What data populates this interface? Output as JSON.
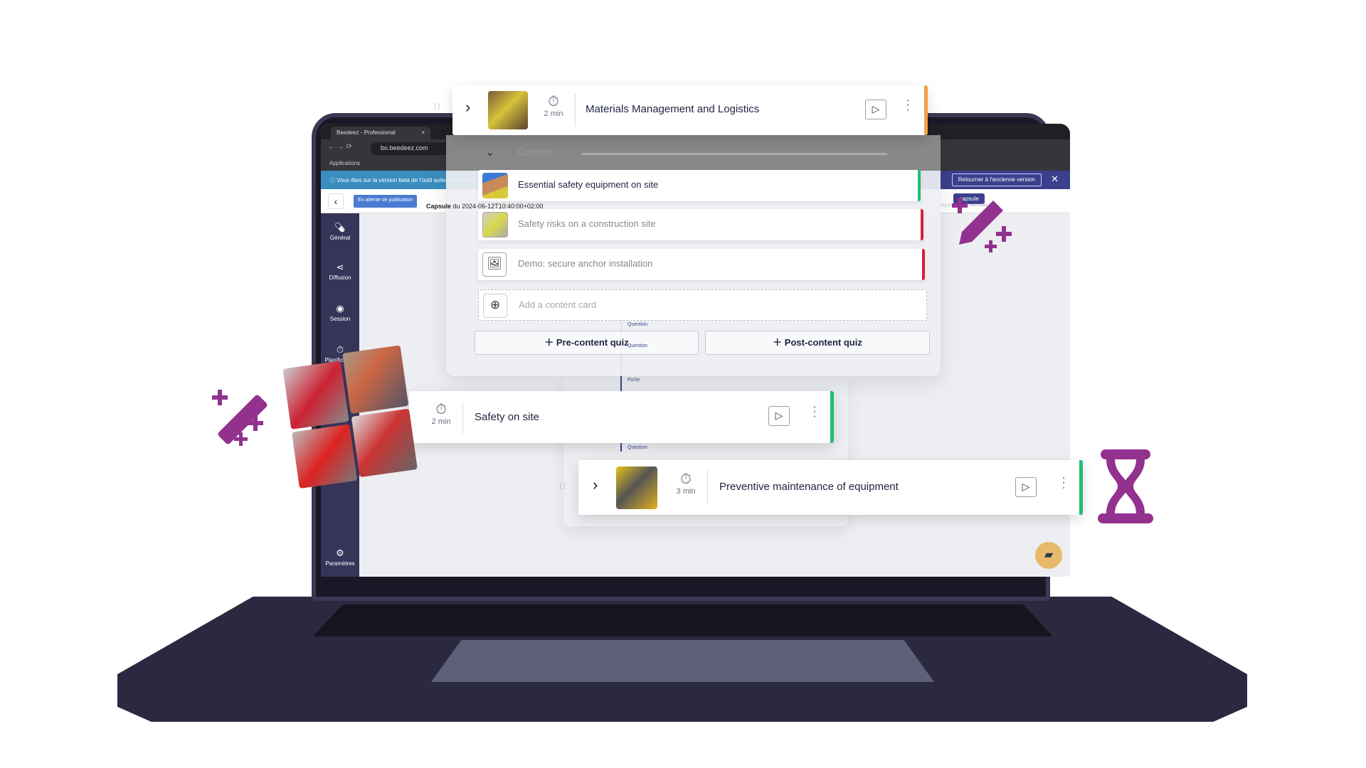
{
  "browser": {
    "tab_title": "Beedeez - Professional",
    "url": "bo.beedeez.com",
    "bookmark": "Applications"
  },
  "banner": {
    "text": "Vous êtes sur la version beta de l'outil auteur Beedeez",
    "old_version": "Retourner à l'ancienne version"
  },
  "header": {
    "status": "En attente de publication",
    "capsule_label": "Capsule",
    "capsule_date": "du 2024-06-12T10:40:00+02:00",
    "capsule_button": "capsule",
    "saved": "Il y a quelques secondes"
  },
  "sidebar": {
    "items": [
      {
        "label": "Général",
        "icon": "pill-icon"
      },
      {
        "label": "Diffusion",
        "icon": "share-icon"
      },
      {
        "label": "Session",
        "icon": "circle-icon"
      },
      {
        "label": "Planification",
        "icon": "stopwatch-icon"
      }
    ],
    "settings": "Paramètres"
  },
  "modules": [
    {
      "title": "Materials Management and Logistics",
      "duration": "2 min",
      "accent": "#f0a04b"
    },
    {
      "title": "Safety on site",
      "duration": "2 min",
      "accent": "#1dbf73"
    },
    {
      "title": "Preventive maintenance of equipment",
      "duration": "3 min",
      "accent": "#1dbf73"
    }
  ],
  "content": {
    "header": "Content",
    "cards": [
      {
        "title": "Essential safety equipment on site",
        "accent": "#1dbf73"
      },
      {
        "title": "Safety risks on a construction site",
        "accent": "#d6213f"
      },
      {
        "title": "Demo: secure anchor installation",
        "accent": "#d6213f"
      }
    ],
    "add_card": "Add a content card",
    "pre_quiz": "Pre-content quiz",
    "post_quiz": "Post-content quiz"
  },
  "timeline": [
    "Question",
    "Question",
    "Fiche",
    "Question"
  ],
  "colors": {
    "brand_purple": "#93318f",
    "sidebar": "#37345a",
    "laptop": "#2b2940"
  }
}
